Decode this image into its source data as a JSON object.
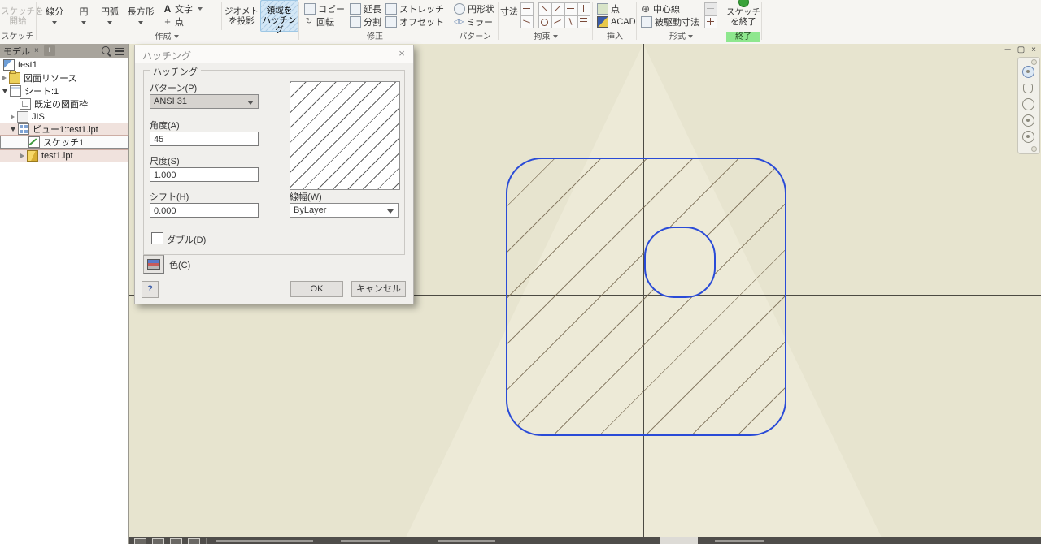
{
  "ribbon": {
    "panels": [
      {
        "label": "スケッチ",
        "buttons": [
          {
            "label": "スケッチを開始",
            "line1": "スケッチを",
            "line2": "開始",
            "disabled": true
          }
        ]
      },
      {
        "label": "作成",
        "has_dropdown": true,
        "buttons": [
          {
            "label": "線分"
          },
          {
            "label": "円"
          },
          {
            "label": "円弧"
          },
          {
            "label": "長方形"
          },
          {
            "label": "文字"
          },
          {
            "label": "点"
          },
          {
            "label": "ジオメトリを投影",
            "line1": "ジオメトリ",
            "line2": "を投影"
          },
          {
            "label": "領域をハッチング",
            "line1": "領域を",
            "line2": "ハッチング",
            "active": true
          }
        ]
      },
      {
        "label": "修正",
        "buttons": [
          {
            "label": "コピー"
          },
          {
            "label": "延長"
          },
          {
            "label": "ストレッチ"
          },
          {
            "label": "回転"
          },
          {
            "label": "分割"
          },
          {
            "label": "オフセット"
          }
        ]
      },
      {
        "label": "パターン",
        "buttons": [
          {
            "label": "円形状"
          },
          {
            "label": "ミラー"
          }
        ]
      },
      {
        "label": "拘束",
        "has_dropdown": true,
        "buttons": [
          {
            "label": "寸法"
          }
        ]
      },
      {
        "label": "挿入",
        "buttons": [
          {
            "label": "点"
          },
          {
            "label": "ACAD"
          }
        ]
      },
      {
        "label": "形式",
        "has_dropdown": true,
        "buttons": [
          {
            "label": "中心線"
          },
          {
            "label": "被駆動寸法"
          }
        ]
      },
      {
        "label": "終了",
        "buttons": [
          {
            "label": "スケッチを終了",
            "line1": "スケッチ",
            "line2": "を終了"
          }
        ]
      }
    ],
    "icons": {
      "text": "A",
      "point": "+",
      "rotate": "↻",
      "mirror": "◁▷",
      "centerline": "⊕"
    }
  },
  "sidebar": {
    "tab": "モデル",
    "tab_close": "×",
    "tab_add": "+",
    "tree": [
      {
        "label": "test1"
      },
      {
        "label": "図面リソース"
      },
      {
        "label": "シート:1"
      },
      {
        "label": "既定の図面枠"
      },
      {
        "label": "JIS"
      },
      {
        "label": "ビュー1:test1.ipt"
      },
      {
        "label": "スケッチ1"
      },
      {
        "label": "test1.ipt"
      }
    ]
  },
  "dialog": {
    "title": "ハッチング",
    "close": "×",
    "group": "ハッチング",
    "pattern_label": "パターン(P)",
    "pattern_value": "ANSI 31",
    "angle_label": "角度(A)",
    "angle_value": "45",
    "scale_label": "尺度(S)",
    "scale_value": "1.000",
    "shift_label": "シフト(H)",
    "shift_value": "0.000",
    "double_label": "ダブル(D)",
    "double_checked": false,
    "lineweight_label": "線幅(W)",
    "lineweight_value": "ByLayer",
    "color_label": "色(C)",
    "help": "?",
    "ok": "OK",
    "cancel": "キャンセル"
  },
  "canvas": {
    "outline_color": "#2a4bd7",
    "hatch_pattern": "ANSI 31",
    "hatch_angle": 45,
    "hatch_scale": "1.000"
  },
  "window": {
    "minimize": "─",
    "restore": "▢",
    "close": "×"
  }
}
